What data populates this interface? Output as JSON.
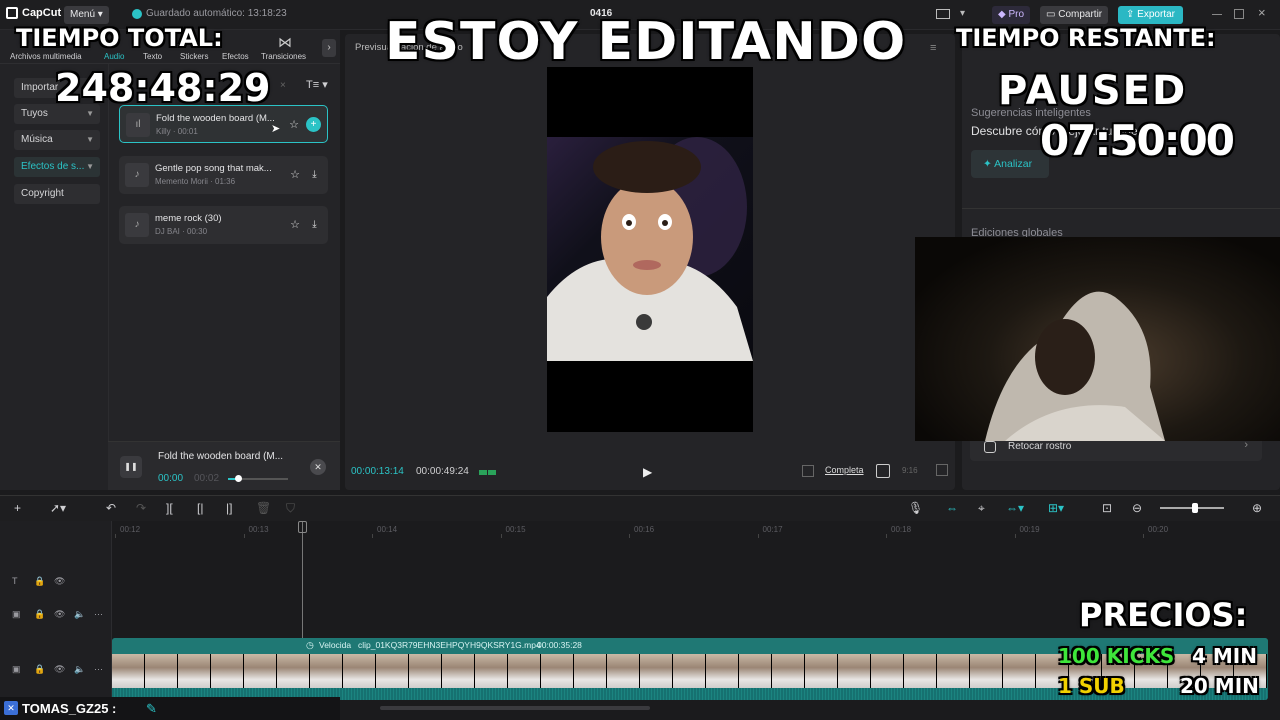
{
  "topbar": {
    "app_name": "CapCut",
    "menu_label": "Menú",
    "autosave": "Guardado automático: 13:18:23",
    "project_name": "0416",
    "pro_label": "Pro",
    "share_label": "Compartir",
    "export_label": "Exportar"
  },
  "left_tabs": [
    {
      "label": "Archivos multimedia"
    },
    {
      "label": "Audio"
    },
    {
      "label": "Texto"
    },
    {
      "label": "Stickers"
    },
    {
      "label": "Efectos"
    },
    {
      "label": "Transiciones"
    }
  ],
  "categories": [
    {
      "label": "Importar"
    },
    {
      "label": "Tuyos"
    },
    {
      "label": "Música"
    },
    {
      "label": "Efectos de s..."
    },
    {
      "label": "Copyright"
    }
  ],
  "tracks": [
    {
      "title": "Fold the wooden board (M...",
      "sub": "Killy · 00:01"
    },
    {
      "title": "Gentle pop song that mak...",
      "sub": "Memento Morii · 01:36"
    },
    {
      "title": "meme rock (30)",
      "sub": "DJ BAI · 00:30"
    }
  ],
  "player": {
    "title": "Fold the wooden board (M...",
    "current": "00:00",
    "total": "00:02",
    "progress": 0.15
  },
  "preview": {
    "header": "Previsualización de audio",
    "time_current": "00:00:13:14",
    "time_total": "00:00:49:24",
    "full_label": "Completa",
    "ratio_label": "9:16"
  },
  "right_panel": {
    "suggestions": "Sugerencias inteligentes",
    "discover": "Descubre cómo mejorar tu video",
    "analyze": "Analizar",
    "global_edits": "Ediciones globales",
    "retouch": "Retocar rostro"
  },
  "timeline": {
    "ruler": [
      "00:12",
      "00:13",
      "00:14",
      "00:15",
      "00:16",
      "00:17",
      "00:18",
      "00:19",
      "00:20"
    ],
    "clip_speed": "Velocida",
    "clip_name": "clip_01KQ3R79EHN3EHPQYH9QKSRY1G.mp4",
    "clip_duration": "00:00:35:28"
  },
  "overlays": {
    "editing": "ESTOY EDITANDO",
    "total_label": "TIEMPO TOTAL:",
    "total_value": "248:48:29",
    "remaining_label": "TIEMPO RESTANTE:",
    "paused": "PAUSED",
    "remaining_value": "07:50:00",
    "prices_label": "PRECIOS:",
    "kicks": "100 KICKS",
    "kicks_time": "4 MIN",
    "sub": "1 SUB",
    "sub_time": "20 MIN"
  },
  "chat": {
    "username": "TOMAS_GZ25 :"
  },
  "colors": {
    "accent": "#2bc3c6",
    "kicks": "#3ee63a",
    "sub": "#f2d100"
  }
}
